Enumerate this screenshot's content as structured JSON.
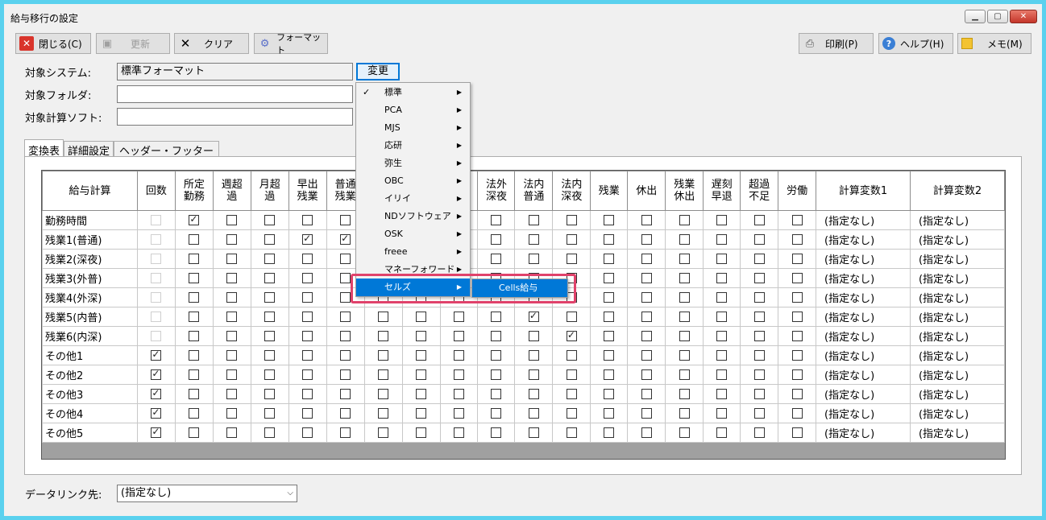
{
  "window": {
    "title": "給与移行の設定"
  },
  "toolbar": {
    "close": "閉じる(C)",
    "update": "更新",
    "clear": "クリア",
    "format": "フォーマット",
    "print": "印刷(P)",
    "help": "ヘルプ(H)",
    "memo": "メモ(M)"
  },
  "form": {
    "system_label": "対象システム:",
    "system_value": "標準フォーマット",
    "folder_label": "対象フォルダ:",
    "folder_value": "",
    "software_label": "対象計算ソフト:",
    "software_value": "",
    "change_button": "変更"
  },
  "tabs": [
    "変換表",
    "詳細設定",
    "ヘッダー・フッター"
  ],
  "grid": {
    "headers": [
      "給与計算",
      "回数",
      "所定\n勤務",
      "週超\n過",
      "月超\n過",
      "早出\n残業",
      "普通\n残業",
      "",
      "",
      "",
      "法外\n深夜",
      "法内\n普通",
      "法内\n深夜",
      "残業",
      "休出",
      "残業\n休出",
      "遅刻\n早退",
      "超過\n不足",
      "労働",
      "計算変数1",
      "計算変数2"
    ],
    "rows": [
      {
        "label": "勤務時間",
        "count_enabled": false,
        "count": false,
        "checks": [
          true,
          false,
          false,
          false,
          false,
          false,
          false,
          false,
          false,
          false,
          false,
          false,
          false,
          false,
          false,
          false,
          false
        ],
        "var1": "(指定なし)",
        "var2": "(指定なし)"
      },
      {
        "label": "残業1(普通)",
        "count_enabled": false,
        "count": false,
        "checks": [
          false,
          false,
          false,
          true,
          true,
          false,
          false,
          false,
          false,
          false,
          false,
          false,
          false,
          false,
          false,
          false,
          false
        ],
        "var1": "(指定なし)",
        "var2": "(指定なし)"
      },
      {
        "label": "残業2(深夜)",
        "count_enabled": false,
        "count": false,
        "checks": [
          false,
          false,
          false,
          false,
          false,
          false,
          false,
          false,
          false,
          false,
          false,
          false,
          false,
          false,
          false,
          false,
          false
        ],
        "var1": "(指定なし)",
        "var2": "(指定なし)"
      },
      {
        "label": "残業3(外普)",
        "count_enabled": false,
        "count": false,
        "checks": [
          false,
          false,
          false,
          false,
          false,
          false,
          false,
          false,
          false,
          false,
          false,
          false,
          false,
          false,
          false,
          false,
          false
        ],
        "var1": "(指定なし)",
        "var2": "(指定なし)"
      },
      {
        "label": "残業4(外深)",
        "count_enabled": false,
        "count": false,
        "checks": [
          false,
          false,
          false,
          false,
          false,
          false,
          false,
          false,
          false,
          false,
          false,
          false,
          false,
          false,
          false,
          false,
          false
        ],
        "var1": "(指定なし)",
        "var2": "(指定なし)"
      },
      {
        "label": "残業5(内普)",
        "count_enabled": false,
        "count": false,
        "checks": [
          false,
          false,
          false,
          false,
          false,
          false,
          false,
          false,
          false,
          true,
          false,
          false,
          false,
          false,
          false,
          false,
          false
        ],
        "var1": "(指定なし)",
        "var2": "(指定なし)"
      },
      {
        "label": "残業6(内深)",
        "count_enabled": false,
        "count": false,
        "checks": [
          false,
          false,
          false,
          false,
          false,
          false,
          false,
          false,
          false,
          false,
          true,
          false,
          false,
          false,
          false,
          false,
          false
        ],
        "var1": "(指定なし)",
        "var2": "(指定なし)"
      },
      {
        "label": "その他1",
        "count_enabled": true,
        "count": true,
        "checks": [
          false,
          false,
          false,
          false,
          false,
          false,
          false,
          false,
          false,
          false,
          false,
          false,
          false,
          false,
          false,
          false,
          false
        ],
        "var1": "(指定なし)",
        "var2": "(指定なし)"
      },
      {
        "label": "その他2",
        "count_enabled": true,
        "count": true,
        "checks": [
          false,
          false,
          false,
          false,
          false,
          false,
          false,
          false,
          false,
          false,
          false,
          false,
          false,
          false,
          false,
          false,
          false
        ],
        "var1": "(指定なし)",
        "var2": "(指定なし)"
      },
      {
        "label": "その他3",
        "count_enabled": true,
        "count": true,
        "checks": [
          false,
          false,
          false,
          false,
          false,
          false,
          false,
          false,
          false,
          false,
          false,
          false,
          false,
          false,
          false,
          false,
          false
        ],
        "var1": "(指定なし)",
        "var2": "(指定なし)"
      },
      {
        "label": "その他4",
        "count_enabled": true,
        "count": true,
        "checks": [
          false,
          false,
          false,
          false,
          false,
          false,
          false,
          false,
          false,
          false,
          false,
          false,
          false,
          false,
          false,
          false,
          false
        ],
        "var1": "(指定なし)",
        "var2": "(指定なし)"
      },
      {
        "label": "その他5",
        "count_enabled": true,
        "count": true,
        "checks": [
          false,
          false,
          false,
          false,
          false,
          false,
          false,
          false,
          false,
          false,
          false,
          false,
          false,
          false,
          false,
          false,
          false
        ],
        "var1": "(指定なし)",
        "var2": "(指定なし)"
      }
    ]
  },
  "menu": {
    "items": [
      {
        "label": "標準",
        "checked": true
      },
      {
        "label": "PCA",
        "checked": false
      },
      {
        "label": "MJS",
        "checked": false
      },
      {
        "label": "応研",
        "checked": false
      },
      {
        "label": "弥生",
        "checked": false
      },
      {
        "label": "OBC",
        "checked": false
      },
      {
        "label": "イリイ",
        "checked": false
      },
      {
        "label": "NDソフトウェア",
        "checked": false
      },
      {
        "label": "OSK",
        "checked": false
      },
      {
        "label": "freee",
        "checked": false
      },
      {
        "label": "マネーフォワード",
        "checked": false
      },
      {
        "label": "セルズ",
        "checked": false
      }
    ],
    "submenu_item": "Cells給与"
  },
  "footer": {
    "datalink_label": "データリンク先:",
    "datalink_value": "(指定なし)"
  }
}
